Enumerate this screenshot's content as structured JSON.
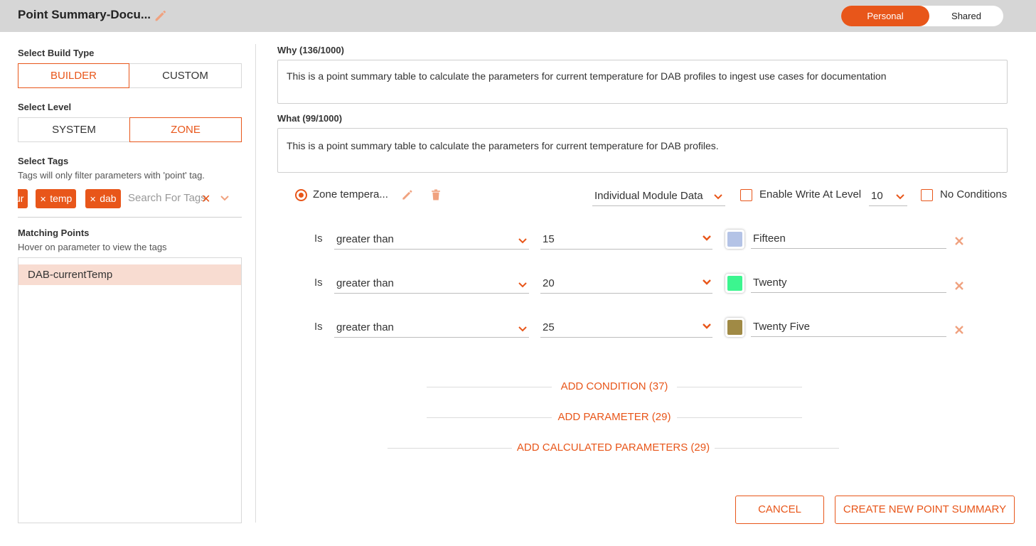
{
  "header": {
    "title": "Point Summary-Docu...",
    "toggle": {
      "personal": "Personal",
      "shared": "Shared",
      "selected": "Personal"
    }
  },
  "sidebar": {
    "build_type": {
      "label": "Select Build Type",
      "options": [
        "BUILDER",
        "CUSTOM"
      ],
      "selected": "BUILDER"
    },
    "level": {
      "label": "Select Level",
      "options": [
        "SYSTEM",
        "ZONE"
      ],
      "selected": "ZONE"
    },
    "tags": {
      "label": "Select Tags",
      "hint": "Tags will only filter parameters with 'point' tag.",
      "chips": [
        "ur",
        "temp",
        "dab"
      ],
      "search_placeholder": "Search For Tags"
    },
    "matching_points": {
      "label": "Matching Points",
      "hint": "Hover on parameter to view the tags",
      "items": [
        "DAB-currentTemp"
      ]
    }
  },
  "main": {
    "why": {
      "label": "Why (136/1000)",
      "value": "This is a point summary table to calculate the parameters for current temperature for DAB profiles to ingest use cases for documentation"
    },
    "what": {
      "label": "What (99/1000)",
      "value": "This is a point summary table to calculate the parameters for current temperature for DAB profiles."
    },
    "parameter": {
      "name": "Zone tempera...",
      "data_source": "Individual Module Data",
      "enable_write_label": "Enable Write At Level",
      "write_level": "10",
      "no_conditions_label": "No Conditions"
    },
    "conditions": [
      {
        "is_label": "Is",
        "operator": "greater than",
        "value": "15",
        "color": "#b4c3e6",
        "label": "Fifteen"
      },
      {
        "is_label": "Is",
        "operator": "greater than",
        "value": "20",
        "color": "#3cf58f",
        "label": "Twenty"
      },
      {
        "is_label": "Is",
        "operator": "greater than",
        "value": "25",
        "color": "#a08a45",
        "label": "Twenty Five"
      }
    ],
    "add_condition": "ADD CONDITION (37)",
    "add_parameter": "ADD PARAMETER (29)",
    "add_calculated": "ADD CALCULATED PARAMETERS (29)",
    "cancel_button": "CANCEL",
    "create_button": "CREATE NEW POINT SUMMARY"
  },
  "colors": {
    "accent": "#e8561a",
    "header_bg": "#d6d6d6",
    "selected_row": "#f8dcd1"
  },
  "icons": [
    "pencil-icon",
    "trash-icon",
    "chevron-down-icon",
    "close-icon"
  ]
}
